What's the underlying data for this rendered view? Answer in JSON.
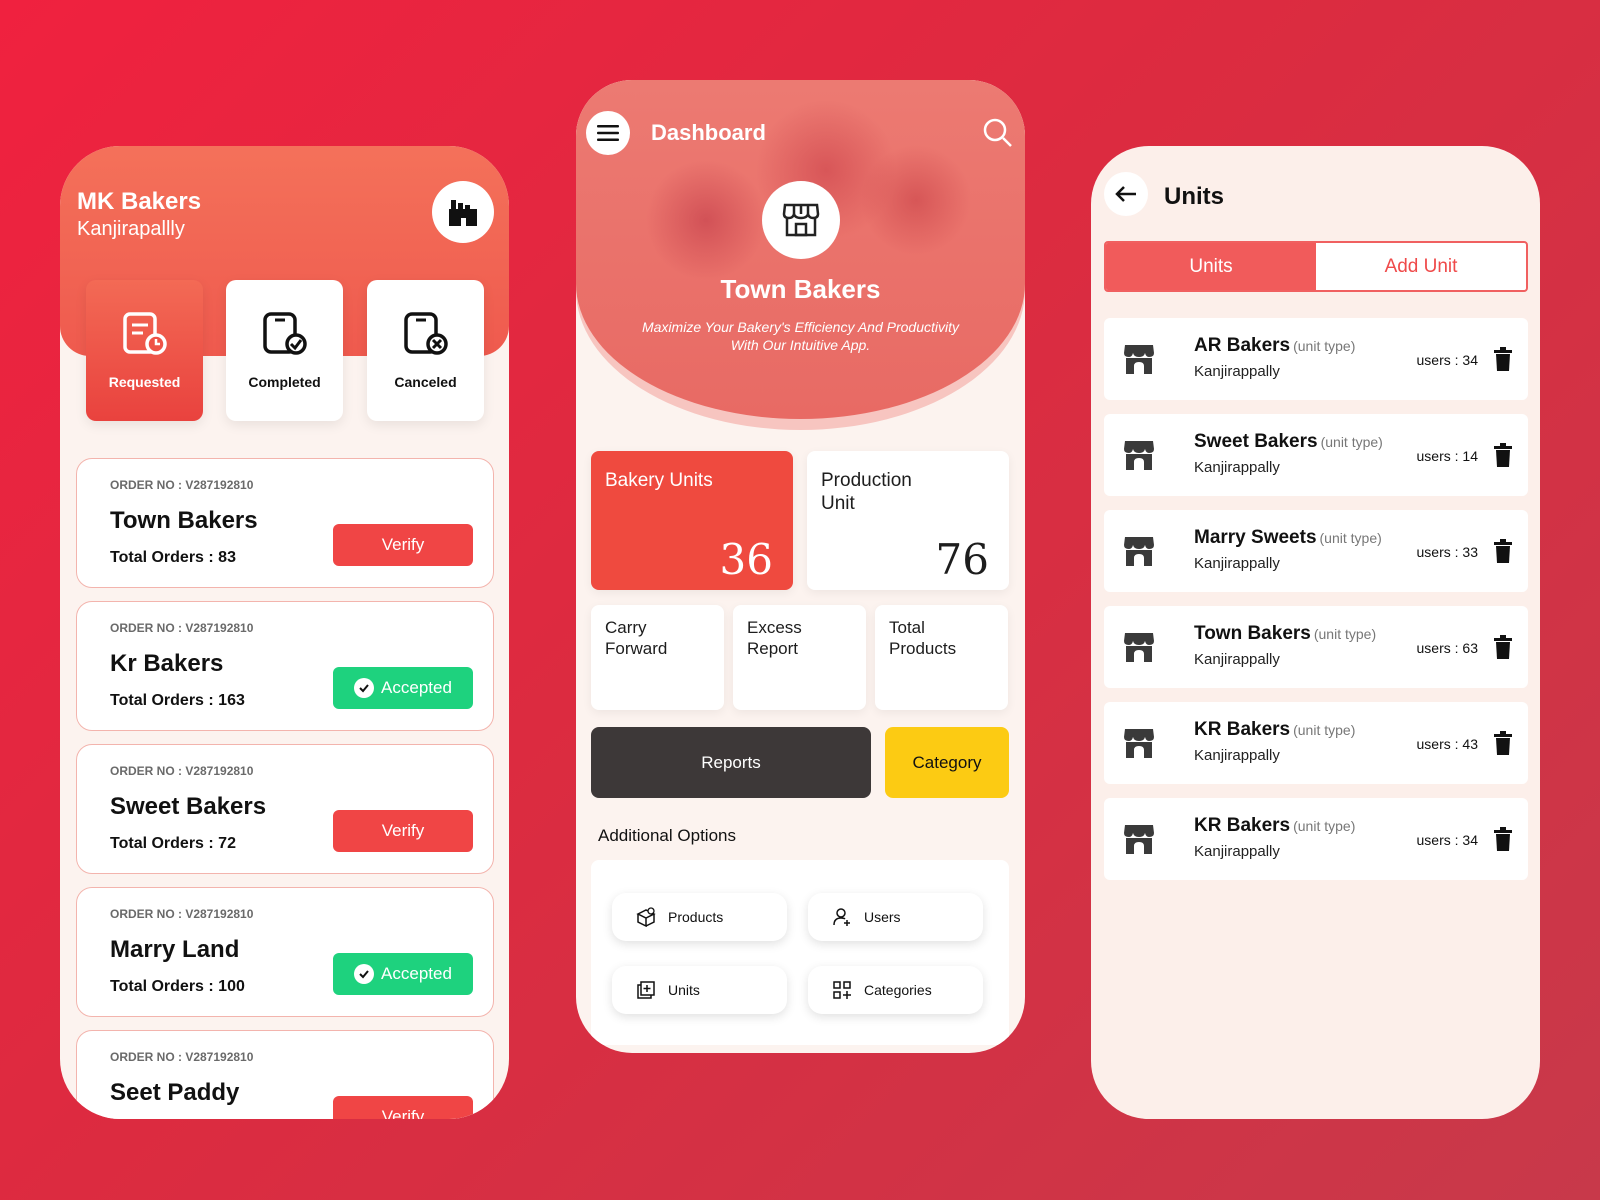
{
  "phone1": {
    "title": "MK Bakers",
    "subtitle": "Kanjirapallly",
    "status_tabs": [
      {
        "label": "Requested"
      },
      {
        "label": "Completed"
      },
      {
        "label": "Canceled"
      }
    ],
    "orders": [
      {
        "order_no": "ORDER NO : V287192810",
        "name": "Town Bakers",
        "total": "Total Orders : 83",
        "action": "Verify"
      },
      {
        "order_no": "ORDER NO : V287192810",
        "name": "Kr Bakers",
        "total": "Total Orders : 163",
        "action": "Accepted"
      },
      {
        "order_no": "ORDER NO : V287192810",
        "name": "Sweet Bakers",
        "total": "Total Orders : 72",
        "action": "Verify"
      },
      {
        "order_no": "ORDER NO : V287192810",
        "name": "Marry Land",
        "total": "Total Orders : 100",
        "action": "Accepted"
      },
      {
        "order_no": "ORDER NO : V287192810",
        "name": "Seet Paddy",
        "total": "",
        "action": "Verify"
      }
    ]
  },
  "phone2": {
    "title": "Dashboard",
    "bakery_name": "Town Bakers",
    "tagline": "Maximize Your Bakery's Efficiency And Productivity With Our Intuitive App.",
    "stats": [
      {
        "label": "Bakery Units",
        "value": "36"
      },
      {
        "label": "Production Unit",
        "value": "76"
      }
    ],
    "small_stats": [
      {
        "label": "Carry Forward"
      },
      {
        "label": "Excess Report"
      },
      {
        "label": "Total Products"
      }
    ],
    "reports_label": "Reports",
    "category_label": "Category",
    "additional_title": "Additional  Options",
    "options": [
      {
        "label": "Products",
        "icon": "box-icon"
      },
      {
        "label": "Users",
        "icon": "user-add-icon"
      },
      {
        "label": "Units",
        "icon": "units-icon"
      },
      {
        "label": "Categories",
        "icon": "grid-add-icon"
      }
    ]
  },
  "phone3": {
    "title": "Units",
    "tabs": [
      {
        "label": "Units",
        "active": true
      },
      {
        "label": "Add Unit",
        "active": false
      }
    ],
    "units": [
      {
        "name": "AR Bakers",
        "type": "(unit type)",
        "location": "Kanjirappally",
        "users": "users : 34"
      },
      {
        "name": "Sweet Bakers",
        "type": "(unit type)",
        "location": "Kanjirappally",
        "users": "users : 14"
      },
      {
        "name": "Marry Sweets",
        "type": "(unit type)",
        "location": "Kanjirappally",
        "users": "users : 33"
      },
      {
        "name": "Town Bakers",
        "type": "(unit type)",
        "location": "Kanjirappally",
        "users": "users : 63"
      },
      {
        "name": "KR Bakers",
        "type": "(unit type)",
        "location": "Kanjirappally",
        "users": "users : 43"
      },
      {
        "name": "KR Bakers",
        "type": "(unit type)",
        "location": "Kanjirappally",
        "users": "users : 34"
      }
    ]
  },
  "colors": {
    "background": "#e42b40",
    "accent_red": "#ef4a3f",
    "accepted_green": "#1ed27e",
    "category_yellow": "#fccb13",
    "reports_dark": "#3d3838"
  }
}
